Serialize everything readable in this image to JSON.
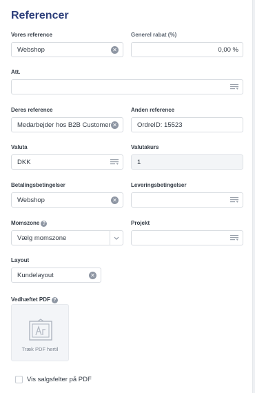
{
  "section_title": "Referencer",
  "our_reference": {
    "label": "Vores reference",
    "value": "Webshop"
  },
  "general_discount": {
    "label": "Generel rabat (%)",
    "value": "0,00 %"
  },
  "att": {
    "label": "Att.",
    "value": ""
  },
  "their_reference": {
    "label": "Deres reference",
    "value": "Medarbejder hos B2B Customer"
  },
  "other_reference": {
    "label": "Anden reference",
    "value": "OrdreID: 15523"
  },
  "currency": {
    "label": "Valuta",
    "value": "DKK"
  },
  "exchange_rate": {
    "label": "Valutakurs",
    "value": "1"
  },
  "payment_terms": {
    "label": "Betalingsbetingelser",
    "value": "Webshop"
  },
  "delivery_terms": {
    "label": "Leveringsbetingelser",
    "value": ""
  },
  "vat_zone": {
    "label": "Momszone",
    "placeholder": "Vælg momszone"
  },
  "project": {
    "label": "Projekt",
    "value": ""
  },
  "layout": {
    "label": "Layout",
    "value": "Kundelayout"
  },
  "attached_pdf": {
    "label": "Vedhæftet PDF",
    "drop_label": "Træk PDF hertil"
  },
  "show_sales_fields": {
    "label": "Vis salgsfelter på PDF",
    "checked": false
  },
  "icons": {
    "clear": "clear-icon",
    "list": "list-icon",
    "help": "help-icon",
    "chevron": "chevron-down-icon",
    "document": "document-icon"
  },
  "colors": {
    "title": "#2c3e7a",
    "icon_gray": "#8e96a3",
    "readonly_bg": "#f3f5f7"
  }
}
